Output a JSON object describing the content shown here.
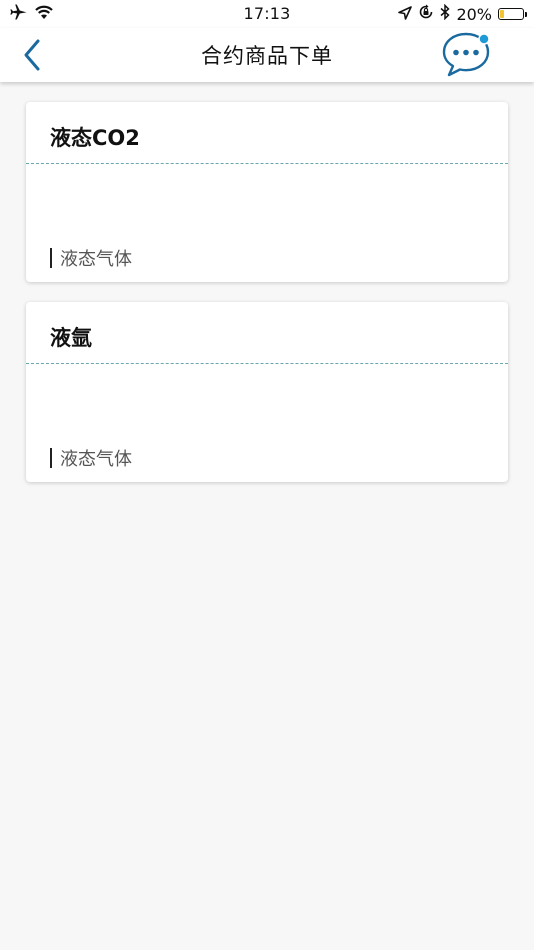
{
  "status_bar": {
    "time": "17:13",
    "battery_percent": "20%",
    "battery_level": 0.2,
    "battery_color": "#f4c430",
    "icons_left": [
      "airplane-icon",
      "wifi-icon"
    ],
    "icons_right": [
      "location-arrow-icon",
      "rotation-lock-icon",
      "bluetooth-icon"
    ]
  },
  "nav": {
    "title": "合约商品下单",
    "back_icon": "chevron-left-icon",
    "chat_icon": "chat-bubble-icon",
    "accent_color": "#1a6aa0",
    "badge_color": "#1e9ad6"
  },
  "products": [
    {
      "name": "液态CO2",
      "category": "液态气体"
    },
    {
      "name": "液氩",
      "category": "液态气体"
    }
  ]
}
